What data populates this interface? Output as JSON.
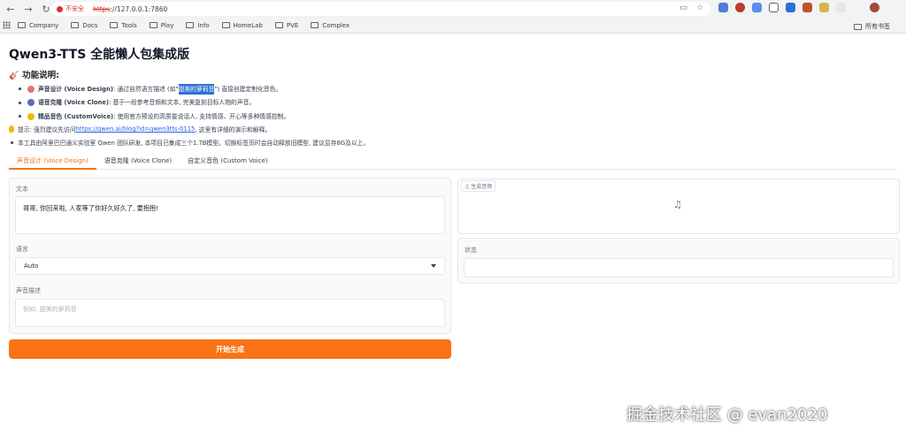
{
  "browser": {
    "security_label": "不安全",
    "url_protocol": "https",
    "url_rest": "://127.0.0.1:7860",
    "bookmarks": [
      "Company",
      "Docs",
      "Tools",
      "Play",
      "Info",
      "HomeLab",
      "PVE",
      "Complex"
    ],
    "all_bookmarks": "所有书签"
  },
  "app": {
    "title": "Qwen3-TTS 全能懒人包集成版",
    "features_heading": "功能说明:",
    "features": [
      {
        "name": "声音设计 (Voice Design)",
        "desc_a": ": 通过自然语言描述 (如\"",
        "desc_hl": "甜美的萝莉音",
        "desc_b": "\") 直接创建定制化音色。"
      },
      {
        "name": "语音克隆 (Voice Clone)",
        "desc": ": 基于一段参考音频和文本, 完美复刻目标人物的声音。"
      },
      {
        "name": "精品音色 (CustomVoice)",
        "desc": ": 使用官方预设的高质量说话人, 支持情感、开心等多种情感控制。"
      }
    ],
    "tip_prefix": "提示: 强烈建议先访问",
    "tip_link": "https://qwen.ai/blog?id=qwen3tts-0115",
    "tip_suffix": ", 这里有详细的演示和解释。",
    "note": "本工具由阿里巴巴通义实验室 Qwen 团队研发, 本项目已集成三个1.7B模型。切换标签页时会自动释放旧模型, 建议显存8G及以上。",
    "tabs": [
      "声音设计 (Voice Design)",
      "语音克隆 (Voice Clone)",
      "自定义音色 (Custom Voice)"
    ],
    "text_label": "文本",
    "text_value": "哥哥, 你回来啦, 人家等了你好久好久了, 要抱抱!",
    "language_label": "语言",
    "language_value": "Auto",
    "voice_desc_label": "声音描述",
    "voice_desc_placeholder": "例如: 甜美的萝莉音",
    "generate_button": "开始生成",
    "audio_label": "生成音频",
    "status_label": "状态",
    "status_value": ""
  },
  "watermark": "掘金技术社区 @ evan2020",
  "colors": {
    "accent": "#f97316",
    "link": "#2563eb",
    "insecure": "#d93025"
  }
}
